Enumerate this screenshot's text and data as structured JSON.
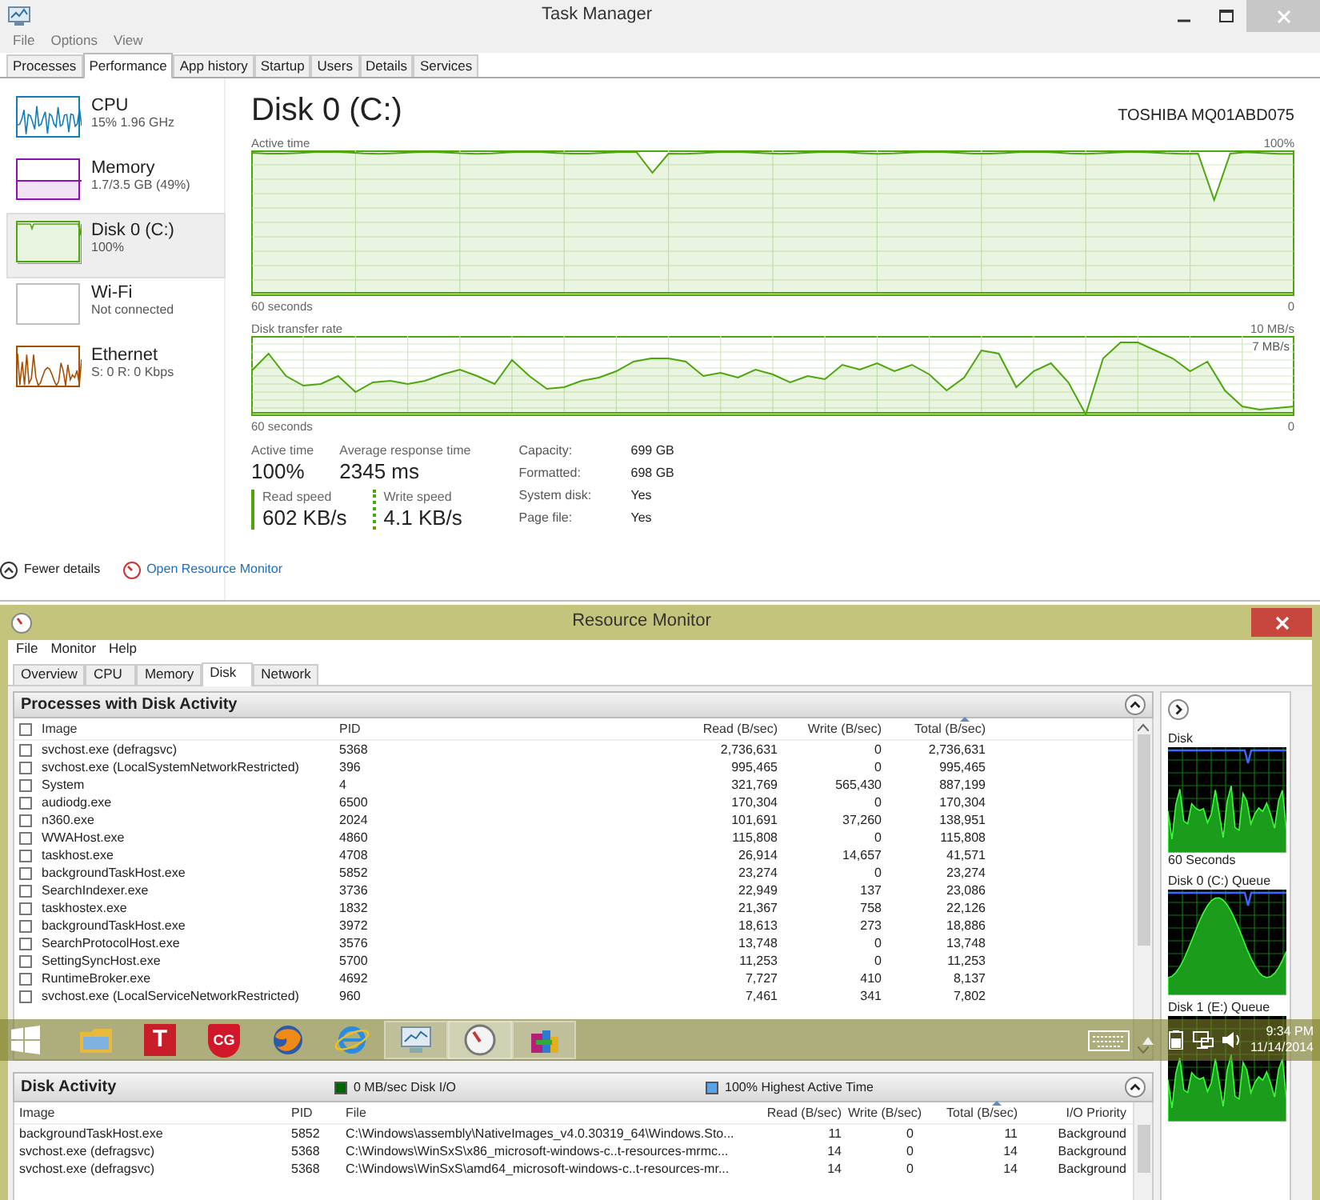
{
  "task_manager": {
    "title": "Task Manager",
    "menu": [
      "File",
      "Options",
      "View"
    ],
    "tabs": [
      {
        "label": "Processes",
        "selected": false
      },
      {
        "label": "Performance",
        "selected": true
      },
      {
        "label": "App history",
        "selected": false
      },
      {
        "label": "Startup",
        "selected": false
      },
      {
        "label": "Users",
        "selected": false
      },
      {
        "label": "Details",
        "selected": false
      },
      {
        "label": "Services",
        "selected": false
      }
    ],
    "sidebar": [
      {
        "title": "CPU",
        "detail": "15%  1.96 GHz",
        "color": "#117dbb",
        "selected": false
      },
      {
        "title": "Memory",
        "detail": "1.7/3.5 GB (49%)",
        "color": "#8b12ae",
        "selected": false
      },
      {
        "title": "Disk 0 (C:)",
        "detail": "100%",
        "color": "#4da60c",
        "selected": true
      },
      {
        "title": "Wi-Fi",
        "detail": "Not connected",
        "color": "#c0c0c0",
        "selected": false
      },
      {
        "title": "Ethernet",
        "detail": "S: 0 R: 0 Kbps",
        "color": "#a74f01",
        "selected": false
      }
    ],
    "disk": {
      "title": "Disk 0 (C:)",
      "model": "TOSHIBA MQ01ABD075",
      "active_chart": {
        "label": "Active time",
        "max": "100%",
        "span": "60 seconds",
        "min": "0"
      },
      "transfer_chart": {
        "label": "Disk transfer rate",
        "max": "10 MB/s",
        "marker": "7 MB/s",
        "span": "60 seconds",
        "min": "0"
      },
      "stats": [
        {
          "label": "Active time",
          "value": "100%"
        },
        {
          "label": "Average response time",
          "value": "2345 ms"
        }
      ],
      "speeds": [
        {
          "label": "Read speed",
          "value": "602 KB/s",
          "kind": "solid"
        },
        {
          "label": "Write speed",
          "value": "4.1 KB/s",
          "kind": "dotted"
        }
      ],
      "properties": [
        {
          "label": "Capacity:",
          "value": "699 GB"
        },
        {
          "label": "Formatted:",
          "value": "698 GB"
        },
        {
          "label": "System disk:",
          "value": "Yes"
        },
        {
          "label": "Page file:",
          "value": "Yes"
        }
      ]
    },
    "footer": {
      "fewer_details": "Fewer details",
      "open_resource_monitor": "Open Resource Monitor"
    }
  },
  "resource_monitor": {
    "title": "Resource Monitor",
    "menu": [
      "File",
      "Monitor",
      "Help"
    ],
    "tabs": [
      {
        "label": "Overview",
        "selected": false
      },
      {
        "label": "CPU",
        "selected": false
      },
      {
        "label": "Memory",
        "selected": false
      },
      {
        "label": "Disk",
        "selected": true
      },
      {
        "label": "Network",
        "selected": false
      }
    ],
    "processes": {
      "title": "Processes with Disk Activity",
      "columns": [
        {
          "label": "Image",
          "sorted": false
        },
        {
          "label": "PID",
          "sorted": false
        },
        {
          "label": "Read (B/sec)",
          "sorted": false
        },
        {
          "label": "Write (B/sec)",
          "sorted": false
        },
        {
          "label": "Total (B/sec)",
          "sorted": true
        }
      ],
      "rows": [
        {
          "checked": false,
          "image": "svchost.exe (defragsvc)",
          "pid": "5368",
          "read": "2,736,631",
          "write": "0",
          "total": "2,736,631"
        },
        {
          "checked": false,
          "image": "svchost.exe (LocalSystemNetworkRestricted)",
          "pid": "396",
          "read": "995,465",
          "write": "0",
          "total": "995,465"
        },
        {
          "checked": false,
          "image": "System",
          "pid": "4",
          "read": "321,769",
          "write": "565,430",
          "total": "887,199"
        },
        {
          "checked": false,
          "image": "audiodg.exe",
          "pid": "6500",
          "read": "170,304",
          "write": "0",
          "total": "170,304"
        },
        {
          "checked": false,
          "image": "n360.exe",
          "pid": "2024",
          "read": "101,691",
          "write": "37,260",
          "total": "138,951"
        },
        {
          "checked": false,
          "image": "WWAHost.exe",
          "pid": "4860",
          "read": "115,808",
          "write": "0",
          "total": "115,808"
        },
        {
          "checked": false,
          "image": "taskhost.exe",
          "pid": "4708",
          "read": "26,914",
          "write": "14,657",
          "total": "41,571"
        },
        {
          "checked": false,
          "image": "backgroundTaskHost.exe",
          "pid": "5852",
          "read": "23,274",
          "write": "0",
          "total": "23,274"
        },
        {
          "checked": false,
          "image": "SearchIndexer.exe",
          "pid": "3736",
          "read": "22,949",
          "write": "137",
          "total": "23,086"
        },
        {
          "checked": false,
          "image": "taskhostex.exe",
          "pid": "1832",
          "read": "21,367",
          "write": "758",
          "total": "22,126"
        },
        {
          "checked": false,
          "image": "backgroundTaskHost.exe",
          "pid": "3972",
          "read": "18,613",
          "write": "273",
          "total": "18,886"
        },
        {
          "checked": false,
          "image": "SearchProtocolHost.exe",
          "pid": "3576",
          "read": "13,748",
          "write": "0",
          "total": "13,748"
        },
        {
          "checked": false,
          "image": "SettingSyncHost.exe",
          "pid": "5700",
          "read": "11,253",
          "write": "0",
          "total": "11,253"
        },
        {
          "checked": false,
          "image": "RuntimeBroker.exe",
          "pid": "4692",
          "read": "7,727",
          "write": "410",
          "total": "8,137"
        },
        {
          "checked": false,
          "image": "svchost.exe (LocalServiceNetworkRestricted)",
          "pid": "960",
          "read": "7,461",
          "write": "341",
          "total": "7,802"
        }
      ],
      "select_all_checked": false
    },
    "disk_activity": {
      "title": "Disk Activity",
      "legend": [
        {
          "label": "0 MB/sec Disk I/O",
          "color": "#006400"
        },
        {
          "label": "100% Highest Active Time",
          "color": "#5ba3e8"
        }
      ],
      "columns": [
        {
          "label": "Image",
          "sorted": false
        },
        {
          "label": "PID",
          "sorted": false
        },
        {
          "label": "File",
          "sorted": false
        },
        {
          "label": "Read (B/sec)",
          "sorted": false
        },
        {
          "label": "Write (B/sec)",
          "sorted": false
        },
        {
          "label": "Total (B/sec)",
          "sorted": true
        },
        {
          "label": "I/O Priority",
          "sorted": false
        }
      ],
      "rows": [
        {
          "image": "backgroundTaskHost.exe",
          "pid": "5852",
          "file": "C:\\Windows\\assembly\\NativeImages_v4.0.30319_64\\Windows.Sto...",
          "read": "11",
          "write": "0",
          "total": "11",
          "priority": "Background"
        },
        {
          "image": "svchost.exe (defragsvc)",
          "pid": "5368",
          "file": "C:\\Windows\\WinSxS\\x86_microsoft-windows-c..t-resources-mrmc...",
          "read": "14",
          "write": "0",
          "total": "14",
          "priority": "Background"
        },
        {
          "image": "svchost.exe (defragsvc)",
          "pid": "5368",
          "file": "C:\\Windows\\WinSxS\\amd64_microsoft-windows-c..t-resources-mr...",
          "read": "14",
          "write": "0",
          "total": "14",
          "priority": "Background"
        }
      ]
    },
    "graphs": [
      {
        "label": "Disk",
        "caption": "60 Seconds"
      },
      {
        "label": "Disk 0 (C:) Queue"
      },
      {
        "label": "Disk 1 (E:) Queue"
      }
    ]
  },
  "taskbar": {
    "apps": [
      {
        "kind": "folder",
        "running": false,
        "selected": false
      },
      {
        "kind": "letter",
        "text": "T",
        "running": false,
        "selected": false
      },
      {
        "kind": "shield",
        "text": "CG",
        "running": false,
        "selected": false
      },
      {
        "kind": "flame",
        "running": false,
        "selected": false
      },
      {
        "kind": "globe",
        "running": false,
        "selected": false
      },
      {
        "kind": "monitor",
        "running": true,
        "selected": false
      },
      {
        "kind": "gauge",
        "running": true,
        "selected": true
      },
      {
        "kind": "blocks",
        "running": true,
        "selected": false
      }
    ],
    "time": "9:34 PM",
    "date": "11/14/2014"
  }
}
